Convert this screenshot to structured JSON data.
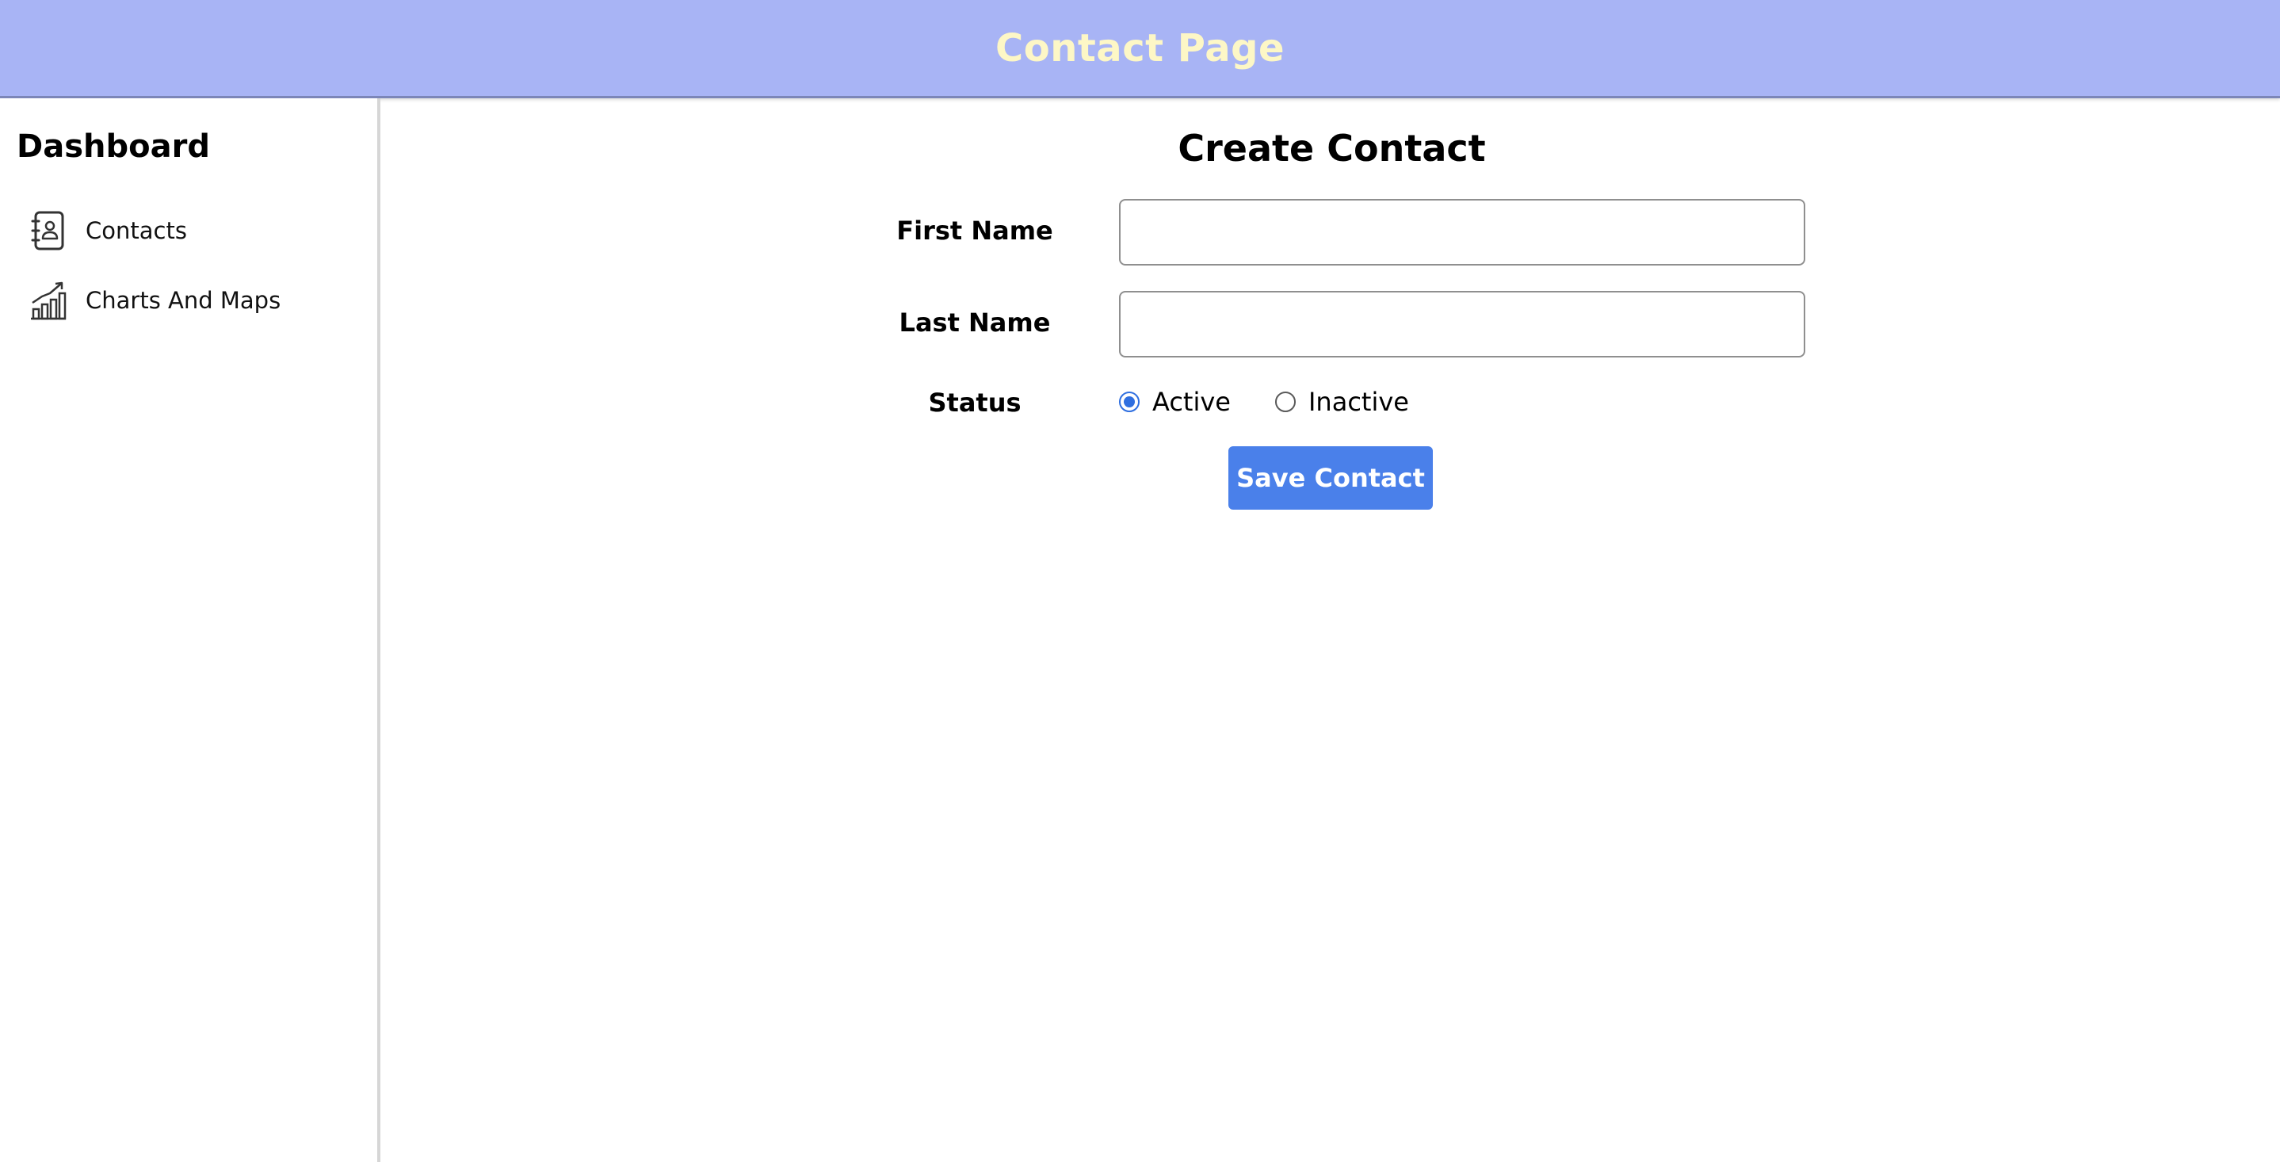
{
  "header": {
    "title": "Contact Page",
    "bg_color": "#a8b4f5",
    "title_color": "#fdf7c6"
  },
  "sidebar": {
    "title": "Dashboard",
    "items": [
      {
        "label": "Contacts",
        "icon": "contact-book-icon"
      },
      {
        "label": "Charts And Maps",
        "icon": "chart-growth-icon"
      }
    ]
  },
  "form": {
    "title": "Create Contact",
    "first_name_label": "First Name",
    "first_name_value": "",
    "last_name_label": "Last Name",
    "last_name_value": "",
    "status_label": "Status",
    "status_options": [
      "Active",
      "Inactive"
    ],
    "status_selected": "Active",
    "save_label": "Save Contact",
    "accent_color": "#4a80ea"
  }
}
